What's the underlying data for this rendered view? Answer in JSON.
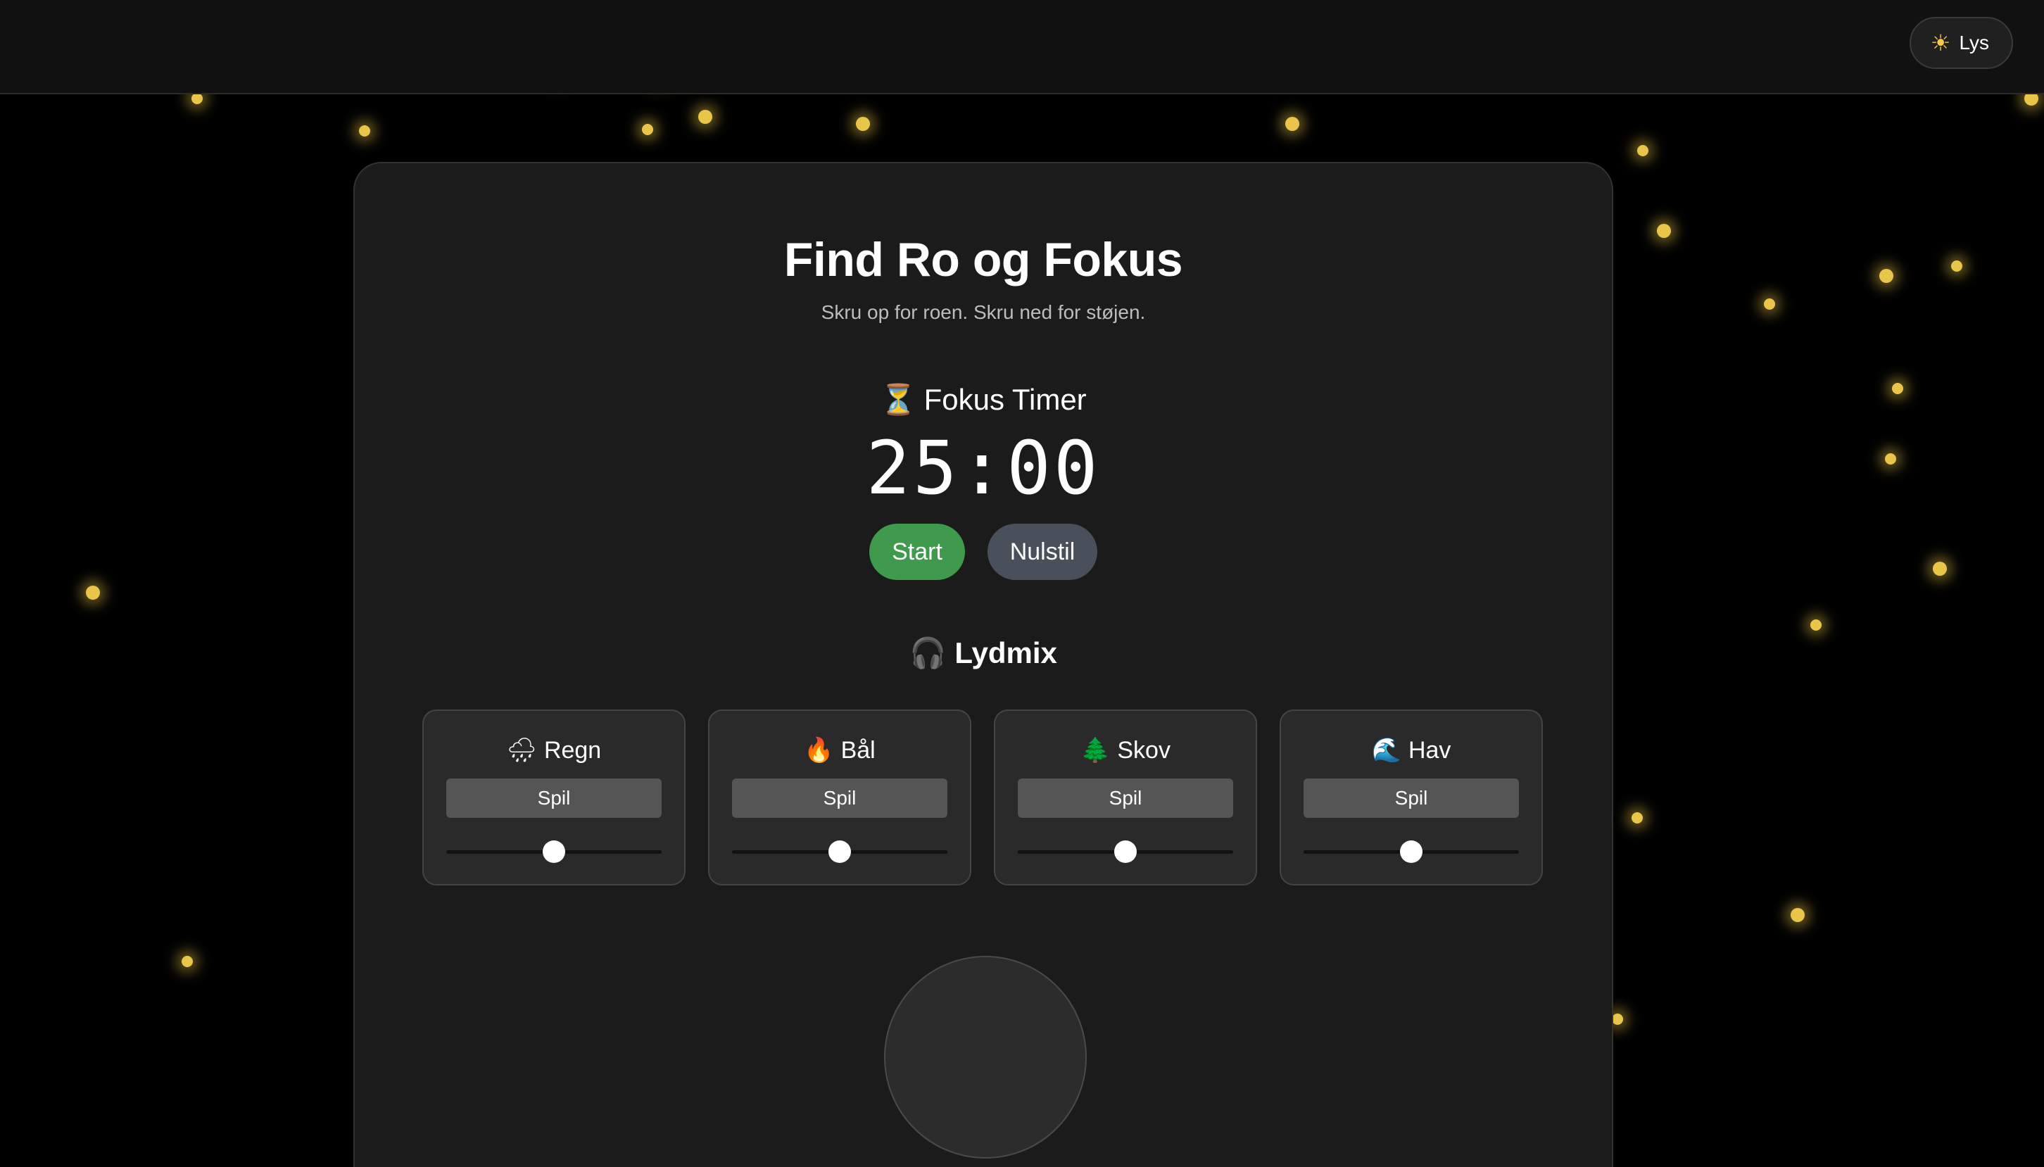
{
  "header": {
    "theme_toggle": {
      "icon": "sun-icon",
      "icon_glyph": "☀",
      "label": "Lys"
    }
  },
  "main": {
    "title": "Find Ro og Fokus",
    "subtitle": "Skru op for roen. Skru ned for støjen."
  },
  "timer": {
    "icon": "hourglass-icon",
    "icon_glyph": "⏳",
    "label": "Fokus Timer",
    "value": "25:00",
    "start_label": "Start",
    "reset_label": "Nulstil",
    "start_color": "#3f9a4d",
    "reset_color": "#4a4f5c"
  },
  "mix": {
    "icon": "headphones-icon",
    "icon_glyph": "🎧",
    "title": "Lydmix",
    "sounds": [
      {
        "icon": "rain-cloud-icon",
        "icon_glyph": "🌧",
        "name": "Regn",
        "play_label": "Spil",
        "volume": 0.5
      },
      {
        "icon": "fire-icon",
        "icon_glyph": "🔥",
        "name": "Bål",
        "play_label": "Spil",
        "volume": 0.5
      },
      {
        "icon": "tree-icon",
        "icon_glyph": "🌲",
        "name": "Skov",
        "play_label": "Spil",
        "volume": 0.5
      },
      {
        "icon": "wave-icon",
        "icon_glyph": "🌊",
        "name": "Hav",
        "play_label": "Spil",
        "volume": 0.5
      }
    ]
  },
  "colors": {
    "background": "#000000",
    "panel": "#1b1b1b",
    "accent_particle": "#e9c64a"
  }
}
